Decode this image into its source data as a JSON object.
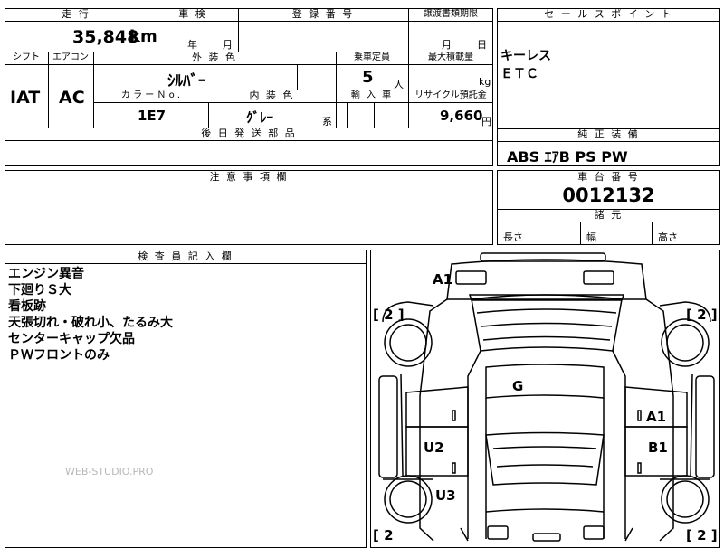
{
  "header": {
    "mileage_label": "走 行",
    "inspection_label": "車 検",
    "registration_label": "登 録 番 号",
    "transfer_label": "譲渡書類期限",
    "sales_point_label": "セ ー ル ス ポ イ ン ト"
  },
  "mileage": {
    "value": "35,848",
    "unit": "km"
  },
  "inspection": {
    "year_unit": "年",
    "month_unit": "月"
  },
  "transfer": {
    "month_unit": "月",
    "day_unit": "日"
  },
  "sales_points": [
    "キーレス",
    "ＥＴＣ"
  ],
  "specs": {
    "shift_label": "シフト",
    "aircon_label": "エアコン",
    "exterior_label": "外 装 色",
    "capacity_label": "乗車定員",
    "max_load_label": "最大積載量",
    "shift_value": "IAT",
    "aircon_value": "AC",
    "exterior_value": "ｼﾙﾊﾞｰ",
    "capacity_value": "5",
    "capacity_unit": "人",
    "max_load_unit": "kg",
    "color_no_label": "カ ラ ー Ｎ o .",
    "interior_label": "内 装 色",
    "import_label": "輸 入 車",
    "recycle_label": "リサイクル預託金",
    "color_no_value": "1E7",
    "interior_value": "ｸﾞﾚｰ",
    "interior_suffix": "系",
    "recycle_value": "9,660",
    "recycle_unit": "円"
  },
  "later_parts_label": "後 日 発 送 部 品",
  "equipment": {
    "label": "純 正 装 備",
    "value": "ABS ｴｱB PS PW"
  },
  "caution_label": "注 意 事 項 欄",
  "chassis": {
    "label": "車 台 番 号",
    "value": "0012132"
  },
  "dimensions": {
    "label": "諸 元",
    "length": "長さ",
    "width": "幅",
    "height": "高さ"
  },
  "inspector": {
    "label": "検 査 員 記 入 欄",
    "notes": [
      "エンジン異音",
      "下廻りＳ大",
      "看板跡",
      "天張切れ・破れ小、たるみ大",
      "センターキャップ欠品",
      "ＰＷフロントのみ"
    ],
    "watermark": "WEB-STUDIO.PRO"
  },
  "diagram": {
    "marks": {
      "a1_top": "A1",
      "g": "G",
      "a1_right": "A1",
      "u2": "U2",
      "b1": "B1",
      "u3": "U3"
    },
    "tires": {
      "tl": "[ 2 ]",
      "tr": "[ 2 ]",
      "bl": "[ 2",
      "br": "[ 2 ]"
    }
  }
}
